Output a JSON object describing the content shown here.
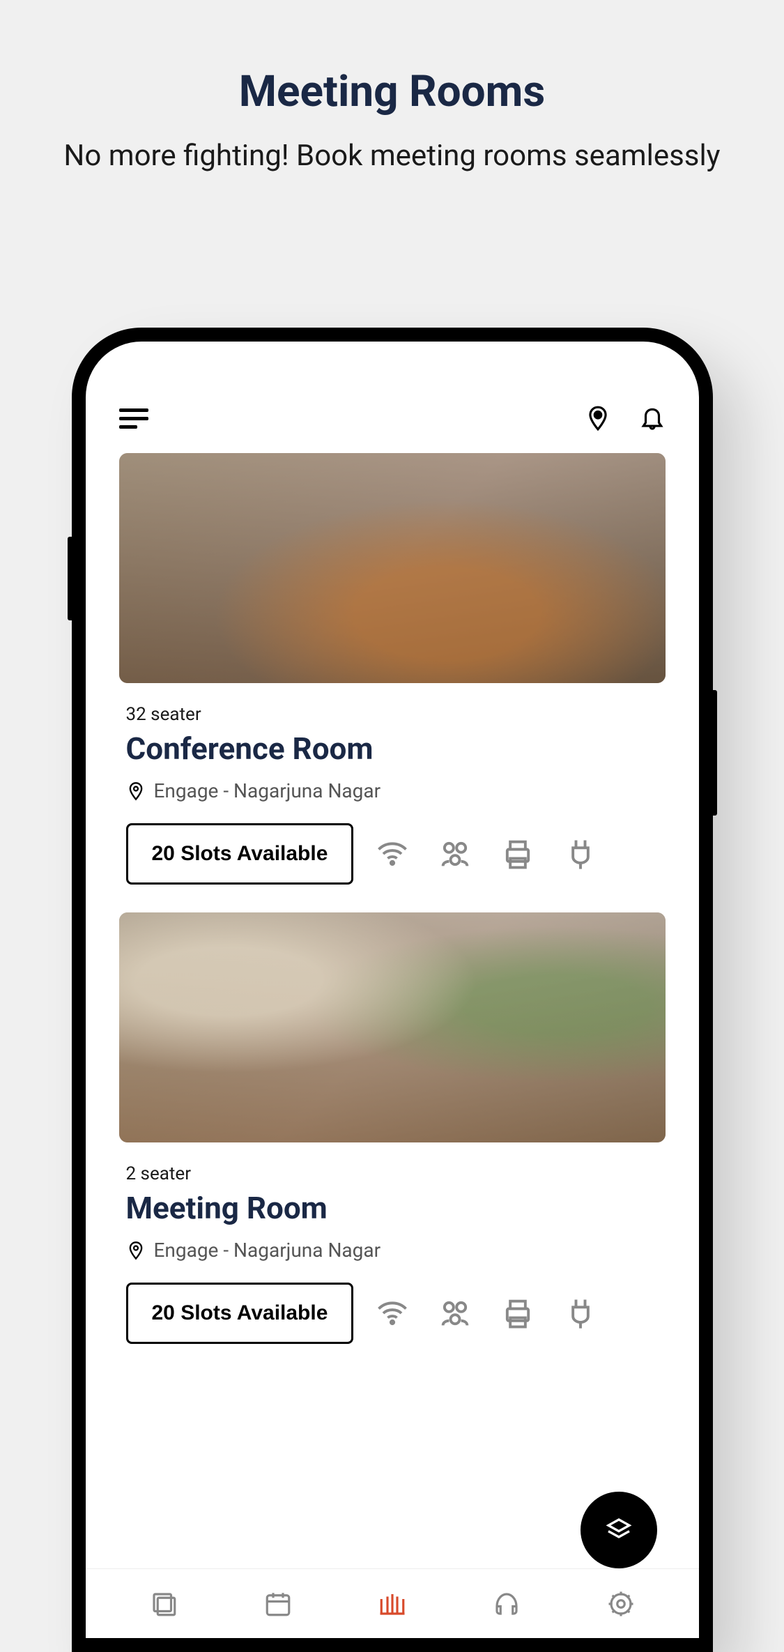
{
  "promo": {
    "title": "Meeting Rooms",
    "subtitle": "No more fighting! Book meeting rooms seamlessly"
  },
  "rooms": [
    {
      "seater": "32 seater",
      "name": "Conference Room",
      "location": "Engage - Nagarjuna Nagar",
      "slots": "20 Slots Available"
    },
    {
      "seater": "2 seater",
      "name": "Meeting Room",
      "location": "Engage - Nagarjuna Nagar",
      "slots": "20 Slots Available"
    }
  ]
}
